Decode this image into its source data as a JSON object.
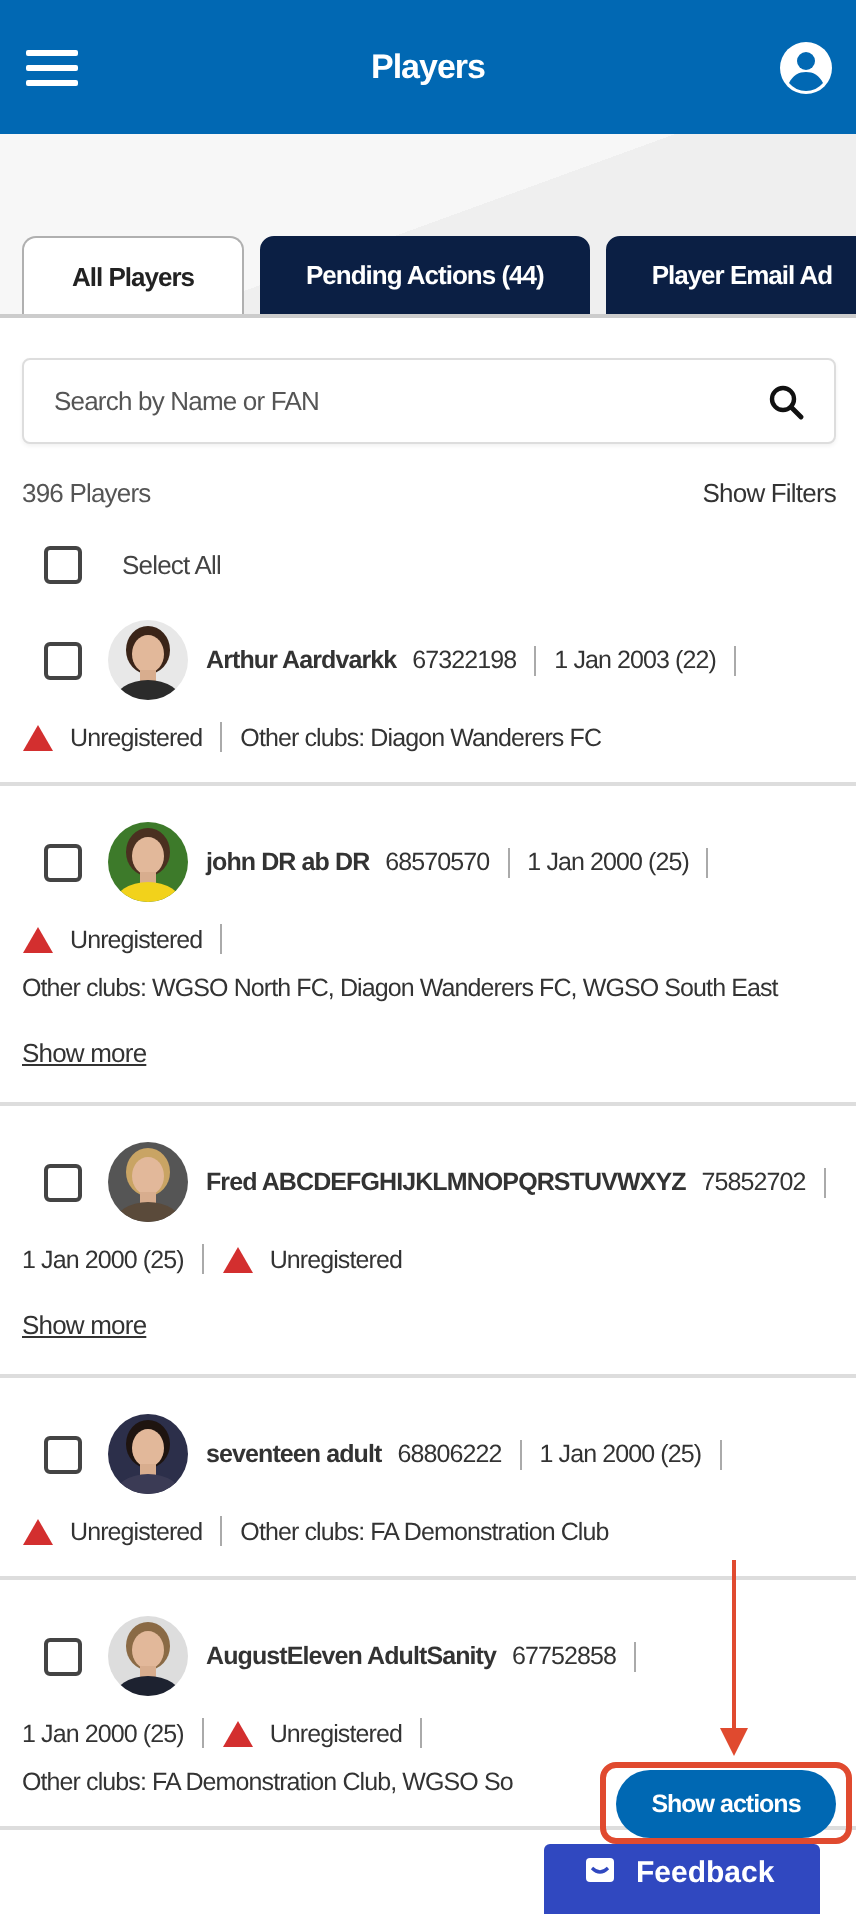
{
  "header": {
    "title": "Players"
  },
  "tabs": [
    {
      "label": "All Players",
      "selected": true
    },
    {
      "label": "Pending Actions (44)",
      "selected": false
    },
    {
      "label": "Player Email Ad",
      "selected": false
    }
  ],
  "search": {
    "placeholder": "Search by Name or FAN"
  },
  "count": "396 Players",
  "filters_link": "Show Filters",
  "select_all": {
    "label": "Select All",
    "checked": false
  },
  "players": [
    {
      "name": "Arthur Aardvarkk",
      "fan": "67322198",
      "dob": "1 Jan 2003 (22)",
      "status": "Unregistered",
      "other_clubs": "Other clubs: Diagon Wanderers FC",
      "checked": false
    },
    {
      "name": "john DR ab DR",
      "fan": "68570570",
      "dob": "1 Jan 2000 (25)",
      "status": "Unregistered",
      "other_clubs": "Other clubs: WGSO North FC, Diagon Wanderers FC, WGSO South East",
      "show_more": "Show more",
      "checked": false
    },
    {
      "name": "Fred ABCDEFGHIJKLMNOPQRSTUVWXYZ",
      "fan": "75852702",
      "dob": "1 Jan 2000 (25)",
      "status": "Unregistered",
      "show_more": "Show more",
      "checked": false
    },
    {
      "name": "seventeen adult",
      "fan": "68806222",
      "dob": "1 Jan 2000 (25)",
      "status": "Unregistered",
      "other_clubs": "Other clubs: FA Demonstration Club",
      "checked": false
    },
    {
      "name": "AugustEleven AdultSanity",
      "fan": "67752858",
      "dob": "1 Jan 2000 (25)",
      "status": "Unregistered",
      "other_clubs": "Other clubs: FA Demonstration Club, WGSO So",
      "checked": false
    }
  ],
  "actions_button": "Show actions",
  "feedback_tab": "Feedback"
}
